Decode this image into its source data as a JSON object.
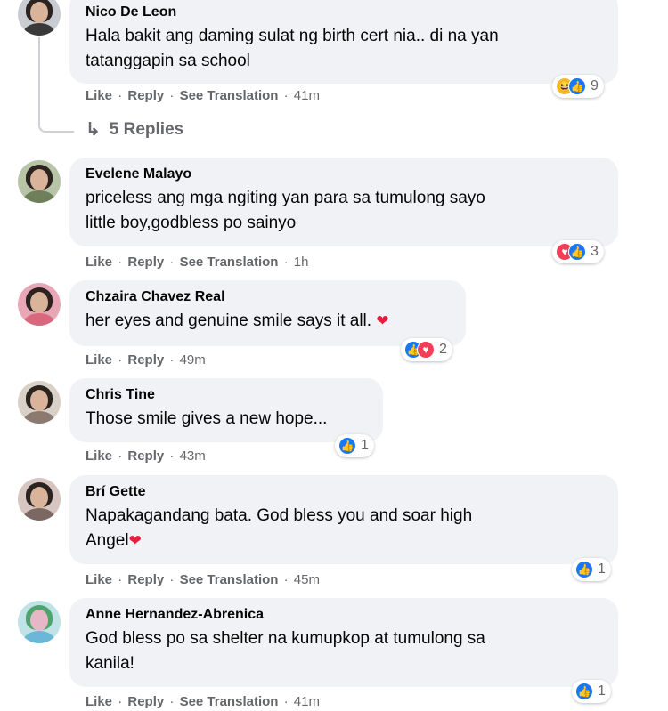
{
  "actions": {
    "like": "Like",
    "reply": "Reply",
    "see_translation": "See Translation",
    "separator": "·"
  },
  "thread": {
    "replies_label": "5 Replies",
    "replies_icon": "reply-arrow-icon"
  },
  "comments": [
    {
      "name": "Nico De Leon",
      "lines": [
        "Hala bakit ang daming sulat ng birth cert nia.. di na yan",
        "tatanggapin sa school"
      ],
      "time": "41m",
      "translate": true,
      "reactions": [
        "haha",
        "like"
      ],
      "count": "9"
    },
    {
      "name": "Evelene Malayo",
      "lines": [
        "priceless ang mga ngiting yan para sa tumulong sayo",
        "little boy,godbless po sainyo"
      ],
      "time": "1h",
      "translate": true,
      "reactions": [
        "love",
        "like"
      ],
      "count": "3"
    },
    {
      "name": "Chzaira Chavez Real",
      "lines": [
        "her eyes and genuine smile says it all."
      ],
      "inline_heart": "❤",
      "time": "49m",
      "translate": false,
      "reactions": [
        "like",
        "love"
      ],
      "count": "2"
    },
    {
      "name": "Chris Tine",
      "lines": [
        "Those smile gives a new hope..."
      ],
      "time": "43m",
      "translate": false,
      "reactions": [
        "like"
      ],
      "count": "1"
    },
    {
      "name": "Brí Gette",
      "lines": [
        "Napakagandang bata. God bless you and soar high",
        "Angel"
      ],
      "inline_heart": "❤",
      "time": "45m",
      "translate": true,
      "reactions": [
        "like"
      ],
      "count": "1"
    },
    {
      "name": "Anne Hernandez-Abrenica",
      "lines": [
        "God bless po sa shelter na kumupkop at tumulong sa",
        "kanila!"
      ],
      "time": "41m",
      "translate": true,
      "reactions": [
        "like"
      ],
      "count": "1"
    }
  ],
  "colors": {
    "bubble": "#f0f2f5",
    "meta": "#65676b",
    "like": "#1877f2",
    "love": "#f33e58",
    "haha": "#f7b928"
  }
}
